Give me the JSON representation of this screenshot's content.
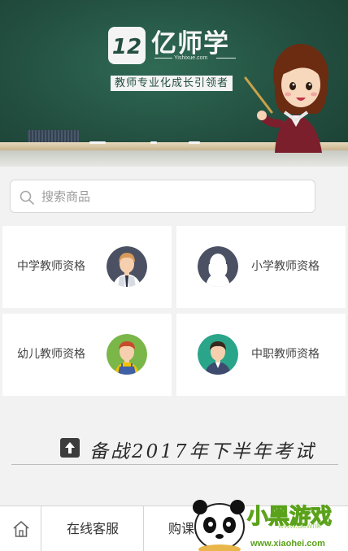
{
  "banner": {
    "logo_mark": "12",
    "brand_name": "亿师学",
    "brand_domain": "Yishixue.com",
    "slogan": "教师专业化成长引领者"
  },
  "search": {
    "placeholder": "搜索商品",
    "value": ""
  },
  "categories": [
    {
      "label": "中学教师资格",
      "icon": "middle-school-teacher-avatar"
    },
    {
      "label": "小学教师资格",
      "icon": "primary-school-teacher-avatar"
    },
    {
      "label": "幼儿教师资格",
      "icon": "kindergarten-teacher-avatar"
    },
    {
      "label": "中职教师资格",
      "icon": "vocational-teacher-avatar"
    }
  ],
  "section": {
    "title": "备战2017年下半年考试"
  },
  "bottom_bar": {
    "home_icon": "home-icon",
    "service_label": "在线客服",
    "buy_label": "购课须知"
  },
  "watermark": {
    "brand": "小黑游戏",
    "site": "www.xiaohei.com",
    "site_partial": "www.downk"
  },
  "colors": {
    "board": "#234f40",
    "card_bg": "#ffffff",
    "page_bg": "#f2f2f2",
    "watermark_green": "#7cc02a"
  }
}
